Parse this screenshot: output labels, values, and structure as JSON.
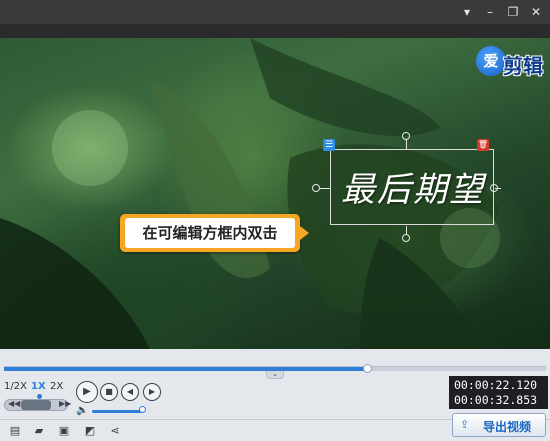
{
  "window": {
    "menu_icon": "dropdown-arrow-icon",
    "min_icon": "minimize-icon",
    "max_icon": "restore-icon",
    "close_icon": "close-icon"
  },
  "logo": {
    "mark": "爱",
    "text": "剪辑"
  },
  "editor": {
    "subtitle": "最后期望",
    "tip": "在可编辑方框内双击"
  },
  "playback": {
    "progress_fraction": 0.67,
    "speeds": [
      "1/2X",
      "1X",
      "2X"
    ],
    "selected_speed": "1X",
    "volume_fraction": 0.9,
    "current_time": "00:00:22.120",
    "total_time": "00:00:32.853"
  },
  "toolbar": {
    "tools": [
      "new-project-icon",
      "open-folder-icon",
      "save-icon",
      "save-as-icon",
      "share-icon"
    ],
    "export_label": "导出视频"
  },
  "colors": {
    "accent": "#2f7fd8",
    "tip_border": "#f5a623",
    "delete": "#d23a2e"
  }
}
